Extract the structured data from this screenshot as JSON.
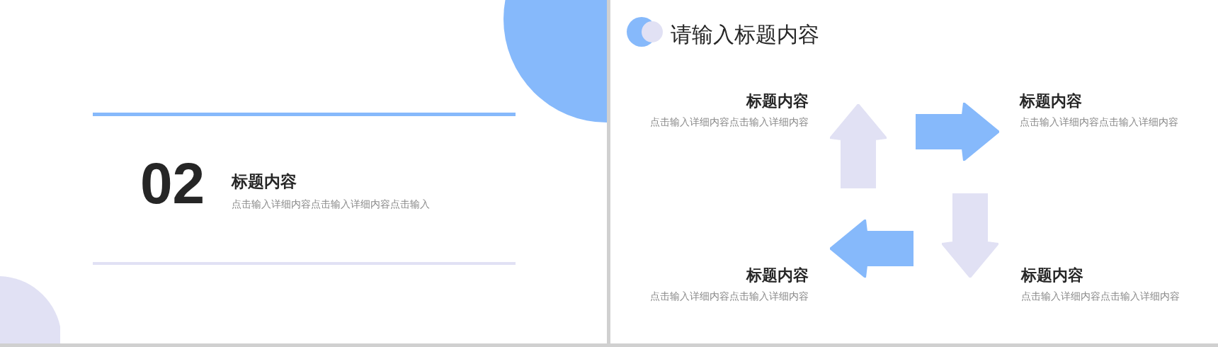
{
  "slides": [
    {
      "kind": "section",
      "number": "02",
      "title": "标题内容",
      "description": "点击输入详细内容点击输入详细内容点击输入"
    },
    {
      "kind": "diagram",
      "title": "请输入标题内容",
      "items": [
        {
          "title": "标题内容",
          "description": "点击输入详细内容点击输入详细内容"
        },
        {
          "title": "标题内容",
          "description": "点击输入详细内容点击输入详细内容"
        },
        {
          "title": "标题内容",
          "description": "点击输入详细内容点击输入详细内容"
        },
        {
          "title": "标题内容",
          "description": "点击输入详细内容点击输入详细内容"
        }
      ]
    }
  ]
}
